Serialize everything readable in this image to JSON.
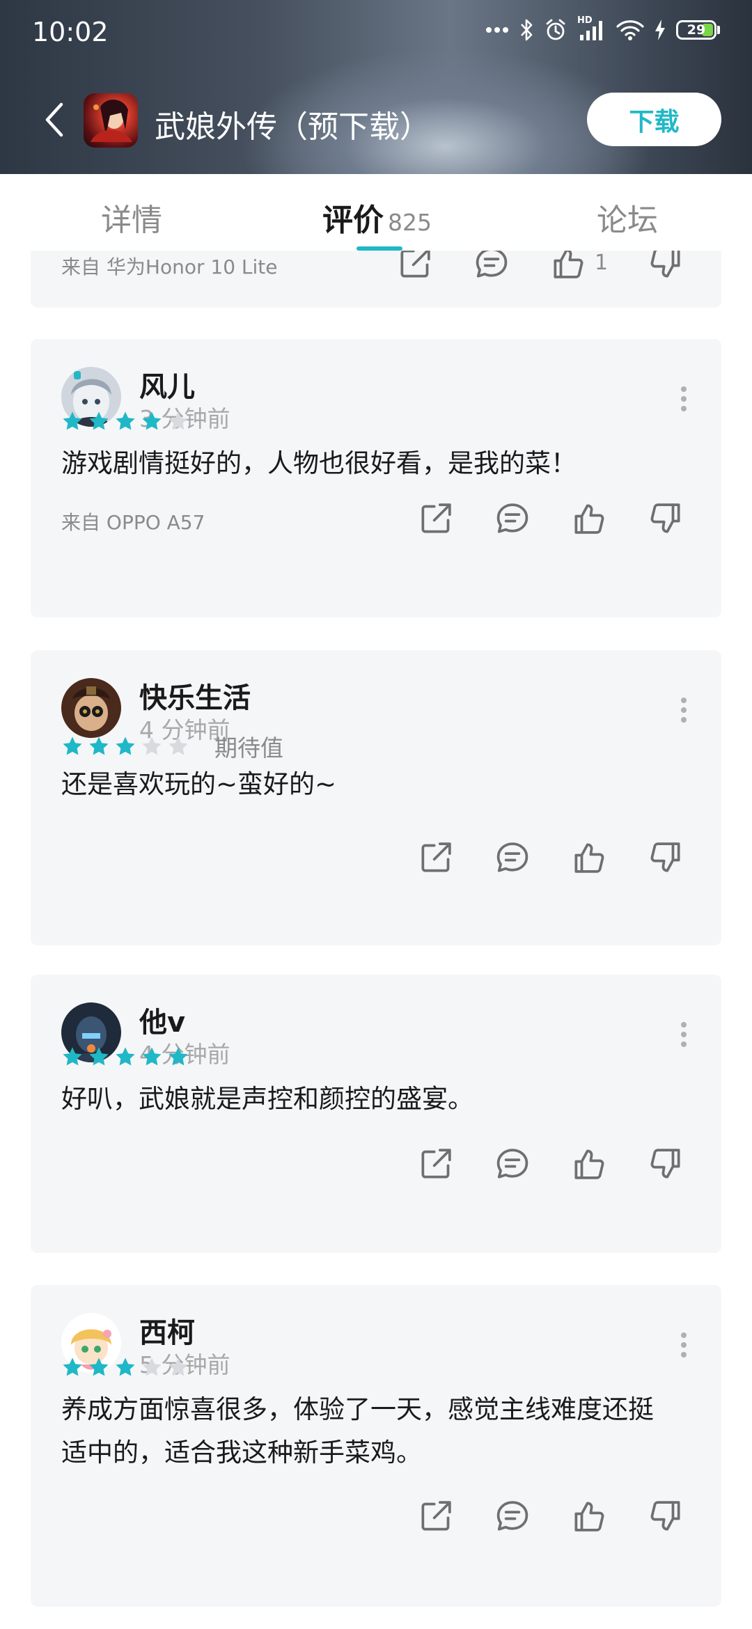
{
  "status_bar": {
    "time": "10:02",
    "signal_label": "HD",
    "battery": "29"
  },
  "header": {
    "app_title": "武娘外传（预下载）",
    "download_label": "下载"
  },
  "tabs": [
    {
      "label": "详情"
    },
    {
      "label": "评价",
      "count": "825"
    },
    {
      "label": "论坛"
    }
  ],
  "colors": {
    "accent": "#1fb8c7",
    "card_bg": "#f5f6f8",
    "star_on": "#1fb8c7",
    "star_off": "#d8dadd"
  },
  "partial_review": {
    "device": "来自 华为Honor 10 Lite",
    "like_count": "1"
  },
  "reviews": [
    {
      "username": "风儿",
      "time": "3 分钟前",
      "stars": 4,
      "text_lines": [
        "游戏剧情挺好的，人物也很好看，是我的菜！"
      ],
      "device": "来自 OPPO A57"
    },
    {
      "username": "快乐生活",
      "time": "4 分钟前",
      "stars": 3,
      "star_tag": "期待值",
      "text_lines": [
        "还是喜欢玩的~蛮好的~"
      ]
    },
    {
      "username": "他v",
      "time": "4 分钟前",
      "stars": 5,
      "text_lines": [
        "好叭，武娘就是声控和颜控的盛宴。"
      ]
    },
    {
      "username": "西柯",
      "time": "5 分钟前",
      "stars": 3,
      "text_lines": [
        "养成方面惊喜很多，体验了一天，感觉主线难度还挺",
        "适中的，适合我这种新手菜鸡。"
      ]
    }
  ]
}
